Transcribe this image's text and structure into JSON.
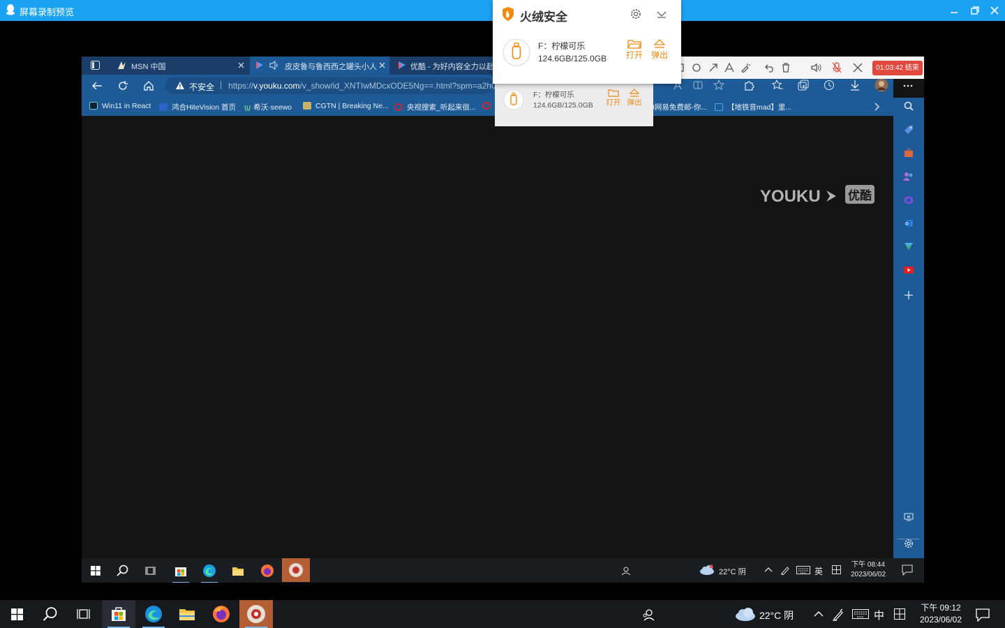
{
  "preview_window": {
    "title": "屏幕录制预览"
  },
  "browser": {
    "tabs": [
      {
        "label": "MSN 中国"
      },
      {
        "label": "皮皮鲁与鲁西西之罐头小人"
      },
      {
        "label": "优酷 - 为好内容全力以赴 -"
      }
    ],
    "security_label": "不安全",
    "url_prefix": "https://",
    "url_host": "v.youku.com",
    "url_rest": "/v_show/id_XNTIwMDcxODE5Ng==.html?spm=a2h0",
    "bookmarks": [
      {
        "label": "Win11 in React"
      },
      {
        "label": "鸿合HiteVision 首页"
      },
      {
        "label": "希沃·seewo"
      },
      {
        "label": "CGTN | Breaking Ne..."
      },
      {
        "label": "央视搜索_听起来很..."
      },
      {
        "label": "3网易免费邮-你..."
      },
      {
        "label": "【地铁音mad】里..."
      }
    ],
    "video_logo": "YOUKU",
    "video_logo_cn": "优酷"
  },
  "recording": {
    "timer": "01:03:42 结束"
  },
  "security_popup": {
    "brand": "火绒安全",
    "drive_name": "F：柠檬可乐",
    "drive_size": "124.6GB/125.0GB",
    "open_label": "打开",
    "eject_label": "弹出"
  },
  "security_popup_ghost": {
    "drive_name": "F：柠檬可乐",
    "drive_size": "124.6GB/125.0GB",
    "open_label": "打开",
    "eject_label": "弹出"
  },
  "inner_taskbar": {
    "weather": "22°C 阴",
    "ime_lang": "英",
    "time": "下午 08:44",
    "date": "2023/06/02"
  },
  "taskbar": {
    "weather": "22°C 阴",
    "ime_lang": "中",
    "time": "下午 09:12",
    "date": "2023/06/02"
  },
  "colors": {
    "title_bar": "#1aa3f3",
    "browser_chrome": "#1e5a95",
    "accent_orange": "#f08a11",
    "record_red": "#e2483e"
  }
}
